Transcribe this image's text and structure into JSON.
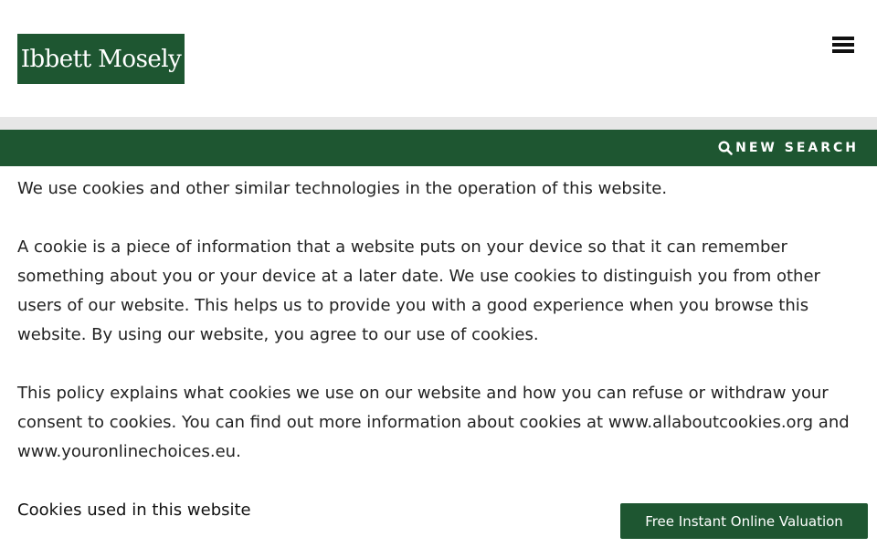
{
  "header": {
    "logo_text": "Ibbett Mosely",
    "menu_icon": "hamburger-menu-icon"
  },
  "search_bar": {
    "label": "NEW SEARCH",
    "icon": "search-icon"
  },
  "content": {
    "paragraphs": [
      "We use cookies and other similar technologies in the operation of this website.",
      "A cookie is a piece of information that a website puts on your device so that it can remember something about you or your device at a later date. We use cookies to distinguish you from other users of our website. This helps us to provide you with a good experience when you browse this website. By using our website, you agree to our use of cookies.",
      "This policy explains what cookies we use on our website and how you can refuse or withdraw your consent to cookies. You can find out more information about cookies at www.allaboutcookies.org and www.youronlinechoices.eu."
    ],
    "heading": "Cookies used in this website"
  },
  "cta": {
    "label": "Free Instant Online Valuation"
  },
  "colors": {
    "brand_green": "#1e5631",
    "strip_gray": "#e7e7e7"
  }
}
